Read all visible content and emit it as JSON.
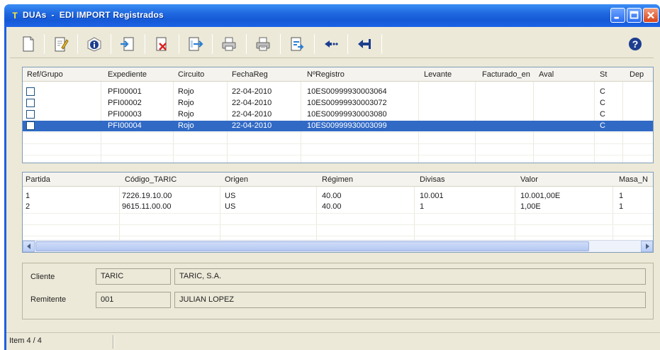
{
  "window": {
    "title": "DUAs  -  EDI IMPORT Registrados",
    "title_icon": "T"
  },
  "toolbar": {
    "buttons": [
      {
        "icon": "new-document-icon"
      },
      {
        "icon": "edit-document-icon"
      },
      {
        "icon": "info-icon"
      },
      {
        "icon": "import-icon"
      },
      {
        "icon": "delete-document-icon"
      },
      {
        "icon": "export-document-icon"
      },
      {
        "icon": "print-icon"
      },
      {
        "icon": "print-preview-icon"
      },
      {
        "icon": "send-document-icon"
      },
      {
        "icon": "add-arrow-icon"
      },
      {
        "icon": "return-arrow-icon"
      },
      {
        "icon": "help-icon"
      }
    ]
  },
  "expedientes": {
    "columns": [
      "Ref/Grupo",
      "Expediente",
      "Circuito",
      "FechaReg",
      "NºRegistro",
      "Levante",
      "Facturado_en",
      "Aval",
      "St",
      "Dep"
    ],
    "rows": [
      {
        "expediente": "PFI00001",
        "circuito": "Rojo",
        "fecha": "22-04-2010",
        "registro": "10ES00999930003064",
        "st": "C",
        "selected": false
      },
      {
        "expediente": "PFI00002",
        "circuito": "Rojo",
        "fecha": "22-04-2010",
        "registro": "10ES00999930003072",
        "st": "C",
        "selected": false
      },
      {
        "expediente": "PFI00003",
        "circuito": "Rojo",
        "fecha": "22-04-2010",
        "registro": "10ES00999930003080",
        "st": "C",
        "selected": false
      },
      {
        "expediente": "PFI00004",
        "circuito": "Rojo",
        "fecha": "22-04-2010",
        "registro": "10ES00999930003099",
        "st": "C",
        "selected": true
      }
    ]
  },
  "partidas": {
    "columns": [
      "Partida",
      "Código_TARIC",
      "Origen",
      "Régimen",
      "Divisas",
      "Valor",
      "Masa_N"
    ],
    "rows": [
      {
        "partida": "1",
        "taric": "7226.19.10.00",
        "origen": "US",
        "regimen": "40.00",
        "divisas": "10.001",
        "valor": "10.001,00E",
        "masa": "1"
      },
      {
        "partida": "2",
        "taric": "9615.11.00.00",
        "origen": "US",
        "regimen": "40.00",
        "divisas": "1",
        "valor": "1,00E",
        "masa": "1"
      }
    ]
  },
  "info": {
    "cliente_label": "Cliente",
    "cliente_code": "TARIC",
    "cliente_name": "TARIC, S.A.",
    "remitente_label": "Remitente",
    "remitente_code": "001",
    "remitente_name": "JULIAN LOPEZ"
  },
  "status": {
    "text": "Item 4 / 4"
  },
  "colors": {
    "titlebar": "#1f68e0",
    "selection": "#316ac5",
    "frame": "#ece9d8"
  }
}
